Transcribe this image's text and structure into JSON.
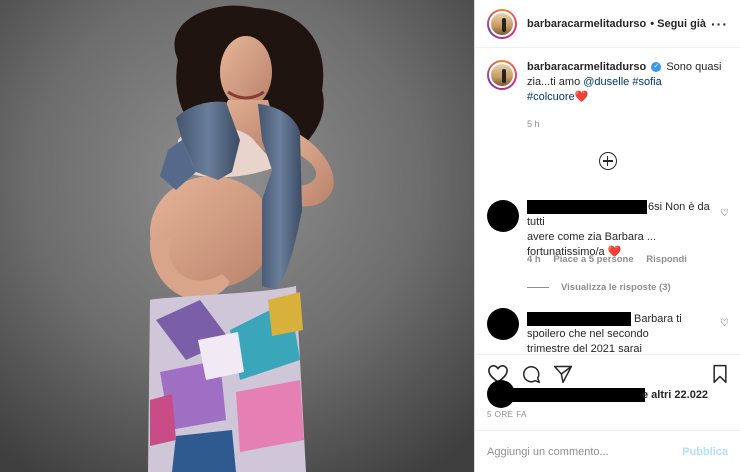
{
  "header": {
    "username": "barbaracarmelitadurso",
    "follow": "• Segui già",
    "more_icon": "more-icon"
  },
  "caption": {
    "username": "barbaracarmelitadurso",
    "text_a": "Sono quasi zia...ti amo ",
    "mention_1": "@duselle",
    "tag_1": "#sofia",
    "tag_2": "#colcuore",
    "heart": "❤️",
    "time": "5 h"
  },
  "load_more_icon": "plus-circle-icon",
  "comments": [
    {
      "user_suffix": "6si",
      "line1": "Non è da tutti",
      "line2": "avere come zia Barbara ...",
      "line3": "fortunatissimo/a ❤️",
      "time": "4 h",
      "likes": "Piace a 5 persone",
      "reply": "Rispondi",
      "view_replies": "Visualizza le risposte (3)"
    },
    {
      "line1": "Barbara ti",
      "line2": "spoilero che nel secondo",
      "line3": "trimestre del 2021 sarai"
    }
  ],
  "actions": {
    "like_icon": "heart-icon",
    "comment_icon": "comment-icon",
    "share_icon": "share-icon",
    "save_icon": "bookmark-icon"
  },
  "likes_text": "e altri 22.022",
  "ago": "5 ORE FA",
  "add_comment": {
    "placeholder": "Aggiungi un commento...",
    "publish": "Pubblica"
  },
  "colors": {
    "accent": "#3897f0",
    "publish_disabled": "#b2dffc",
    "muted": "#8e8e8e",
    "heart": "#e0245e"
  }
}
